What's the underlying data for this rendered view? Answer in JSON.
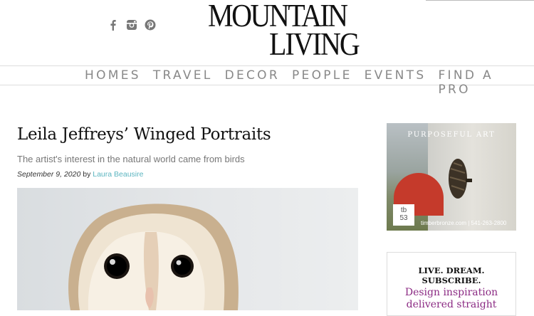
{
  "header": {
    "logo_line1": "MOUNTAIN",
    "logo_line2": "LIVING",
    "social_icons": [
      "facebook-icon",
      "instagram-icon",
      "pinterest-icon"
    ]
  },
  "nav": {
    "items": [
      {
        "label": "HOMES"
      },
      {
        "label": "TRAVEL"
      },
      {
        "label": "DECOR"
      },
      {
        "label": "PEOPLE"
      },
      {
        "label": "EVENTS"
      },
      {
        "label": "FIND A PRO"
      }
    ]
  },
  "article": {
    "title": "Leila Jeffreys’ Winged Portraits",
    "subtitle": "The artist's interest in the natural world came from birds",
    "date": "September 9, 2020",
    "by": "by",
    "author": "Laura Beausire"
  },
  "ads": {
    "ad1": {
      "headline": "PURPOSEFUL ART",
      "logo_line1": "tb",
      "logo_line2": "53",
      "footer": "timberbronze.com | 541-263-2800"
    },
    "ad2": {
      "heading": "LIVE. DREAM. SUBSCRIBE.",
      "body_line1": "Design inspiration",
      "body_line2": "delivered straight"
    }
  },
  "colors": {
    "author_link": "#5bb5c0",
    "nav_text": "#888888",
    "subscribe_purple": "#8b2a83"
  }
}
